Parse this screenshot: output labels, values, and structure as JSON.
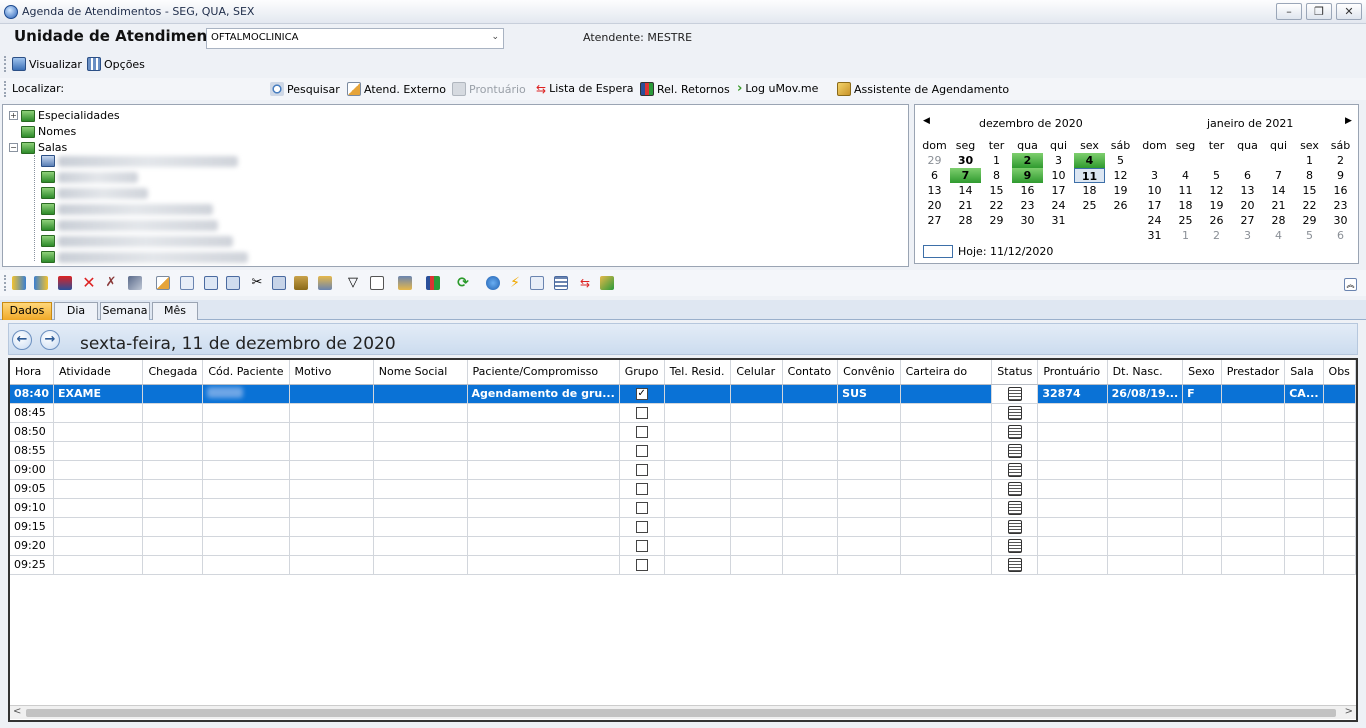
{
  "window": {
    "title": "Agenda de Atendimentos - SEG, QUA, SEX",
    "min": "–",
    "max": "❐",
    "close": "✕"
  },
  "unit": {
    "label": "Unidade de Atendimento",
    "value": "OFTALMOCLINICA",
    "atendente": "Atendente: MESTRE"
  },
  "menu": {
    "visualizar": "Visualizar",
    "opcoes": "Opções"
  },
  "toolbar": {
    "localizar": "Localizar:",
    "pesquisar": "Pesquisar",
    "atend_externo": "Atend. Externo",
    "prontuario": "Prontuário",
    "lista_espera": "Lista de Espera",
    "rel_retornos": "Rel. Retornos",
    "log_umov": "Log uMov.me",
    "assistente": "Assistente de Agendamento"
  },
  "tree": {
    "especialidades": "Especialidades",
    "nomes": "Nomes",
    "salas": "Salas"
  },
  "calendar": {
    "month1": "dezembro de 2020",
    "month2": "janeiro de 2021",
    "weekdays": [
      "dom",
      "seg",
      "ter",
      "qua",
      "qui",
      "sex",
      "sáb"
    ],
    "today_label": "Hoje: 11/12/2020",
    "accent": "#2f9a2f"
  },
  "tabs": {
    "dados": "Dados",
    "dia": "Dia",
    "semana": "Semana",
    "mes": "Mês"
  },
  "date_title": "sexta-feira, 11 de dezembro de 2020",
  "grid": {
    "columns": [
      "Hora",
      "Atividade",
      "Chegada",
      "Cód. Paciente",
      "Motivo",
      "Nome Social",
      "Paciente/Compromisso",
      "Grupo",
      "Tel. Resid.",
      "Celular",
      "Contato",
      "Convênio",
      "Carteira do",
      "Status",
      "Prontuário",
      "Dt. Nasc.",
      "Sexo",
      "Prestador",
      "Sala",
      "Obs"
    ],
    "rows": [
      {
        "hora": "08:40",
        "atividade": "EXAME",
        "paciente": "Agendamento de gru...",
        "grupo": true,
        "convenio": "SUS",
        "prontuario": "32874",
        "nasc": "26/08/19...",
        "sexo": "F",
        "sala": "CA..."
      },
      {
        "hora": "08:45"
      },
      {
        "hora": "08:50"
      },
      {
        "hora": "08:55"
      },
      {
        "hora": "09:00"
      },
      {
        "hora": "09:05"
      },
      {
        "hora": "09:10"
      },
      {
        "hora": "09:15"
      },
      {
        "hora": "09:20"
      },
      {
        "hora": "09:25"
      }
    ],
    "selection_color": "#0a72d6"
  }
}
